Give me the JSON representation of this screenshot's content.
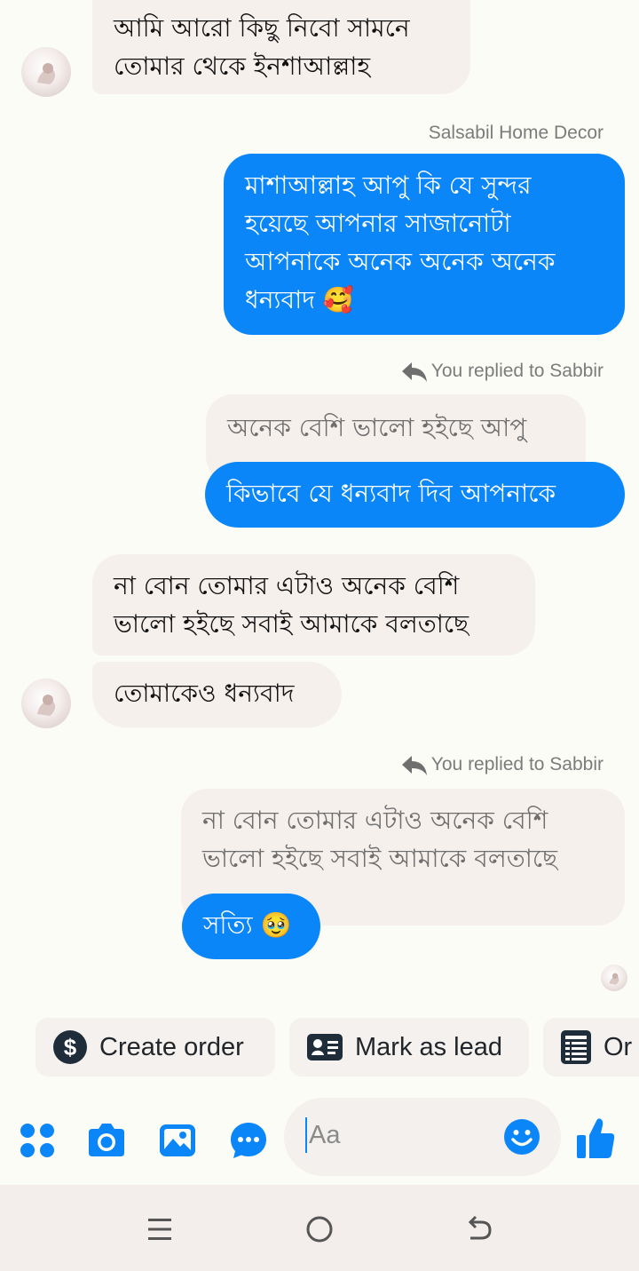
{
  "messages": {
    "m1": {
      "line1": "আমি আরো কিছু নিবো সামনে",
      "line2": "তোমার থেকে ইনশাআল্লাহ"
    },
    "sender_label": "Salsabil Home Decor",
    "m2": {
      "line1": "মাশাআল্লাহ আপু কি যে সুন্দর",
      "line2": "হয়েছে আপনার সাজানোটা",
      "line3": "আপনাকে অনেক অনেক অনেক",
      "line4": "ধন্যবাদ 🥰"
    },
    "reply1": {
      "meta": "You replied to Sabbir",
      "quoted": "অনেক বেশি ভালো হইছে আপু",
      "text": "কিভাবে যে ধন্যবাদ দিব আপনাকে"
    },
    "m3": {
      "line1": "না বোন তোমার এটাও অনেক বেশি",
      "line2": "ভালো হইছে সবাই আমাকে বলতাছে"
    },
    "m4": {
      "line1": "তোমাকেও ধন্যবাদ"
    },
    "reply2": {
      "meta": "You replied to Sabbir",
      "quoted_line1": "না বোন তোমার এটাও অনেক বেশি",
      "quoted_line2": "ভালো হইছে সবাই আমাকে বলতাছে",
      "text": "সত্যি 🥹"
    }
  },
  "quick_actions": [
    {
      "label": "Create order",
      "icon": "dollar-circle-icon"
    },
    {
      "label": "Mark as lead",
      "icon": "contact-card-icon"
    },
    {
      "label": "Or",
      "icon": "document-list-icon"
    }
  ],
  "composer": {
    "placeholder": "Aa",
    "tools": [
      "apps-grid-icon",
      "camera-icon",
      "gallery-icon",
      "chat-bubble-icon"
    ],
    "emoji_icon": "smiley-icon",
    "like_icon": "thumbs-up-icon"
  },
  "colors": {
    "accent": "#0a86f9",
    "background": "#fcfcf7",
    "incoming_bubble": "#f6f0ed"
  }
}
